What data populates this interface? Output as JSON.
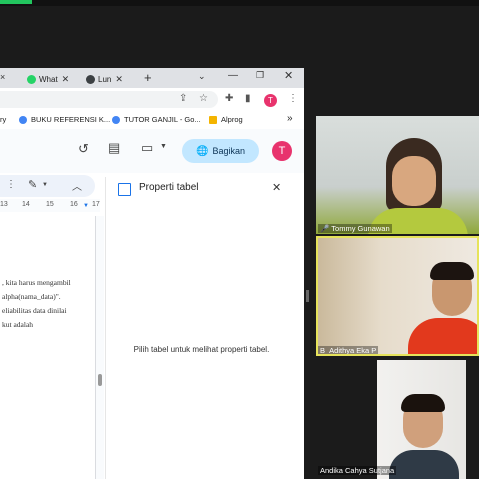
{
  "browser": {
    "tabs": [
      {
        "label": "What",
        "color": "#25d366"
      },
      {
        "label": "Lun",
        "color": "#3c4043"
      }
    ],
    "new_tab": "+",
    "profile_initial": "T",
    "bookmarks": [
      {
        "label": "ry",
        "color": "#999999"
      },
      {
        "label": "BUKU REFERENSI K...",
        "color": "#4285f4"
      },
      {
        "label": "TUTOR GANJIL - Go...",
        "color": "#4285f4"
      },
      {
        "label": "Alprog",
        "color": "#f4b400"
      }
    ],
    "more_bookmarks": "»"
  },
  "docs": {
    "share_label": "Bagikan",
    "avatar_initial": "T",
    "ruler": [
      "13",
      "14",
      "15",
      "16",
      "17"
    ],
    "lines": [
      ", kita harus mengambil",
      "alpha(nama_data)\".",
      "eliabilitas data dinilai",
      "kut adalah"
    ]
  },
  "panel": {
    "title": "Properti tabel",
    "message": "Pilih tabel untuk melihat properti tabel."
  },
  "participants": [
    {
      "name": "Tommy Gunawan",
      "muted": true
    },
    {
      "name": "B_Adithya Eka P",
      "muted": false,
      "speaking": true
    },
    {
      "name": "Andika Cahya Sutjana",
      "muted": false
    }
  ]
}
